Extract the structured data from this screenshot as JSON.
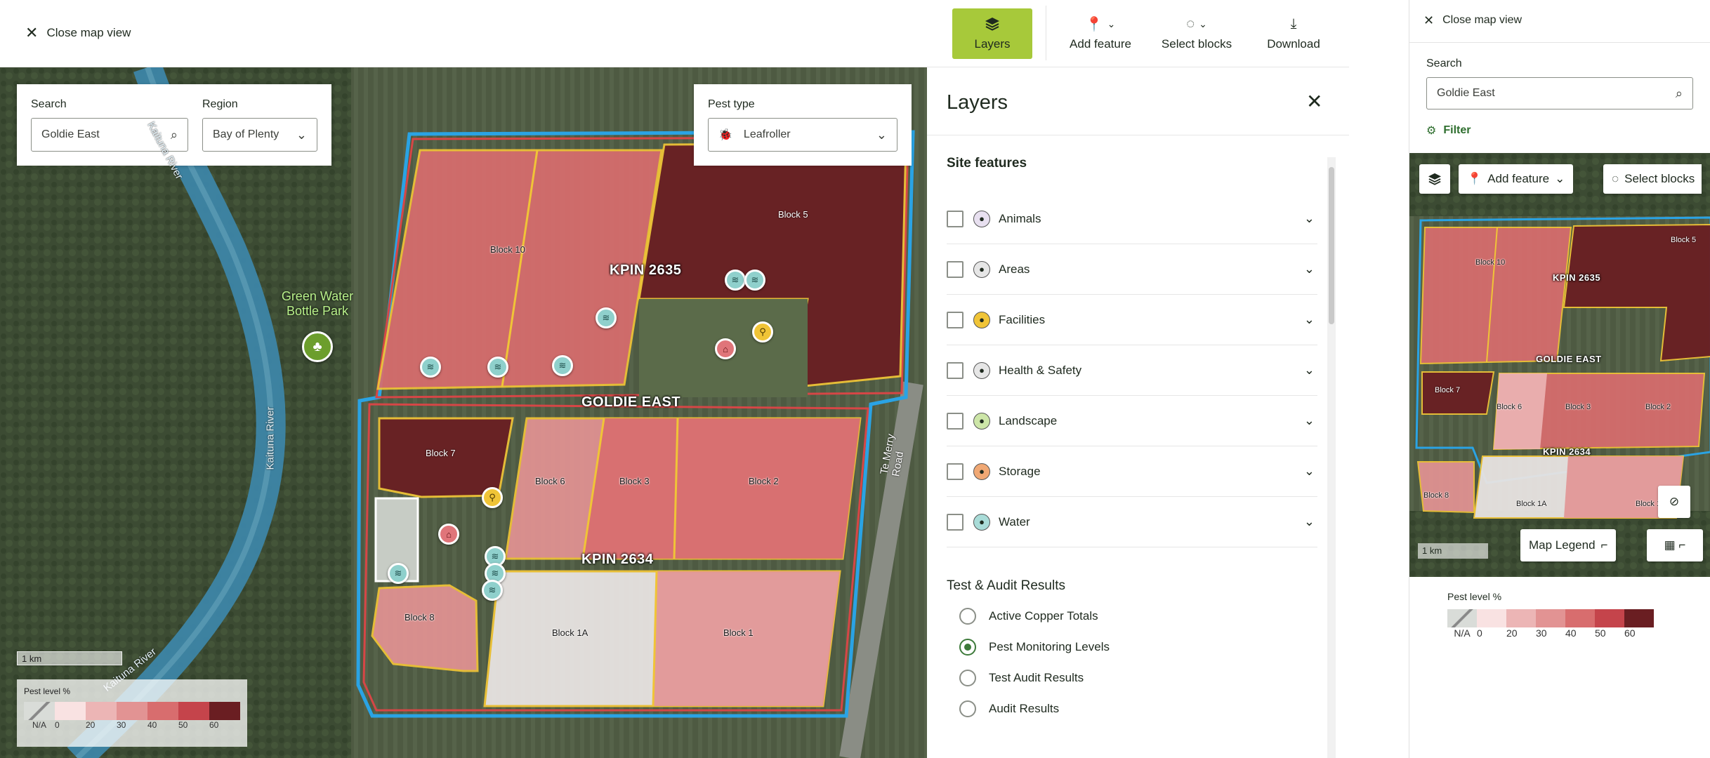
{
  "topbar": {
    "close_label": "Close map view",
    "buttons": [
      {
        "label": "Layers",
        "icon": "layers-icon",
        "active": true
      },
      {
        "label": "Add feature",
        "icon": "pin-plus-icon"
      },
      {
        "label": "Select blocks",
        "icon": "select-icon"
      },
      {
        "label": "Download",
        "icon": "download-icon"
      }
    ]
  },
  "map": {
    "search": {
      "label": "Search",
      "value": "Goldie East"
    },
    "region": {
      "label": "Region",
      "value": "Bay of Plenty"
    },
    "pest_type": {
      "label": "Pest type",
      "value": "Leafroller"
    },
    "labels": {
      "park": "Green Water Bottle Park",
      "river1": "Kaituna River",
      "river2": "Kaituna River",
      "river3": "Kaituna River",
      "road": "Te Merry Road",
      "kpin_top": "KPIN 2635",
      "goldie": "GOLDIE EAST",
      "kpin_bottom": "KPIN 2634"
    },
    "blocks": [
      "Block 10",
      "Block 5",
      "Block 7",
      "Block 6",
      "Block 3",
      "Block 2",
      "Block 8",
      "Block 1A",
      "Block 1"
    ],
    "scale": "1 km",
    "legend": {
      "title": "Pest level %",
      "labels": [
        "N/A",
        "0",
        "20",
        "30",
        "40",
        "50",
        "60"
      ],
      "colors": [
        "#d9dcd8",
        "#f9e2e2",
        "#ecb5b5",
        "#e29393",
        "#d86d6e",
        "#c5444b",
        "#6a1e22"
      ]
    }
  },
  "layers": {
    "title": "Layers",
    "site_features_title": "Site features",
    "features": [
      {
        "label": "Animals",
        "icon": "paw-icon",
        "color": "#e8e0f0"
      },
      {
        "label": "Areas",
        "icon": "grid-icon",
        "color": "#e6e6e6"
      },
      {
        "label": "Facilities",
        "icon": "toilet-icon",
        "color": "#f0c437"
      },
      {
        "label": "Health & Safety",
        "icon": "shield-icon",
        "color": "#e6e6e6"
      },
      {
        "label": "Landscape",
        "icon": "landscape-icon",
        "color": "#cde6a8"
      },
      {
        "label": "Storage",
        "icon": "shed-icon",
        "color": "#f0a874"
      },
      {
        "label": "Water",
        "icon": "water-icon",
        "color": "#a9dcd8"
      }
    ],
    "results_title": "Test & Audit Results",
    "results": [
      {
        "label": "Active Copper Totals",
        "selected": false
      },
      {
        "label": "Pest Monitoring Levels",
        "selected": true
      },
      {
        "label": "Test Audit Results",
        "selected": false
      },
      {
        "label": "Audit Results",
        "selected": false
      }
    ]
  },
  "mobile": {
    "close_label": "Close map view",
    "search": {
      "label": "Search",
      "value": "Goldie East"
    },
    "filter_label": "Filter",
    "add_feature": "Add feature",
    "select_blocks": "Select blocks",
    "kpin_top": "KPIN 2635",
    "goldie": "GOLDIE EAST",
    "kpin_bottom": "KPIN 2634",
    "blocks": [
      "Block 10",
      "Block 5",
      "Block 7",
      "Block 6",
      "Block 3",
      "Block 2",
      "Block 8",
      "Block 1A",
      "Block 1"
    ],
    "scale": "1 km",
    "map_legend": "Map Legend",
    "legend": {
      "title": "Pest level %",
      "labels": [
        "N/A",
        "0",
        "20",
        "30",
        "40",
        "50",
        "60"
      ]
    }
  }
}
